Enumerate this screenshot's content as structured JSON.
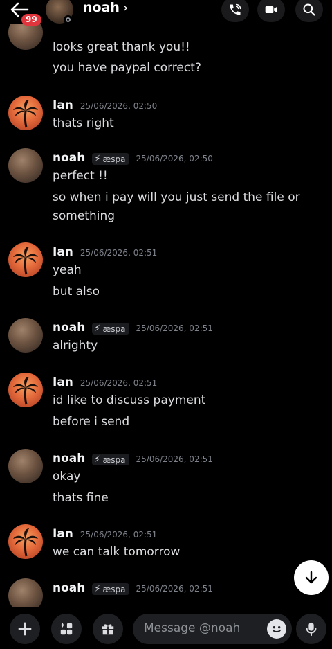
{
  "header": {
    "unread_count": "99",
    "name": "noah",
    "chevron": "›",
    "icons": [
      "back-arrow-icon",
      "phone-call-icon",
      "video-camera-icon",
      "search-icon"
    ]
  },
  "messages": [
    {
      "author": "",
      "tag": "",
      "time": "",
      "avatar": "girl",
      "lines": [
        "looks great thank you!!",
        "you have paypal correct?"
      ]
    },
    {
      "author": "Ian",
      "tag": "",
      "time": "25/06/2026, 02:50",
      "avatar": "palm",
      "lines": [
        "thats right"
      ]
    },
    {
      "author": "noah",
      "tag": "æspa",
      "time": "25/06/2026, 02:50",
      "avatar": "girl",
      "lines": [
        "perfect !!",
        "so when i pay will you just send the file or",
        "something"
      ]
    },
    {
      "author": "Ian",
      "tag": "",
      "time": "25/06/2026, 02:51",
      "avatar": "palm",
      "lines": [
        "yeah",
        "but also"
      ]
    },
    {
      "author": "noah",
      "tag": "æspa",
      "time": "25/06/2026, 02:51",
      "avatar": "girl",
      "lines": [
        "alrighty"
      ]
    },
    {
      "author": "Ian",
      "tag": "",
      "time": "25/06/2026, 02:51",
      "avatar": "palm",
      "lines": [
        "id like to discuss payment",
        "before i send"
      ]
    },
    {
      "author": "noah",
      "tag": "æspa",
      "time": "25/06/2026, 02:51",
      "avatar": "girl",
      "lines": [
        "okay",
        "thats fine"
      ]
    },
    {
      "author": "Ian",
      "tag": "",
      "time": "25/06/2026, 02:51",
      "avatar": "palm",
      "lines": [
        "we can talk tomorrow"
      ]
    },
    {
      "author": "noah",
      "tag": "æspa",
      "time": "25/06/2026, 02:51",
      "avatar": "girl",
      "lines": []
    }
  ],
  "composer": {
    "placeholder": "Message @noah",
    "icons": [
      "plus-icon",
      "apps-icon",
      "gift-icon",
      "emoji-icon",
      "microphone-icon"
    ]
  },
  "scroll_down_icon": "arrow-down-icon"
}
